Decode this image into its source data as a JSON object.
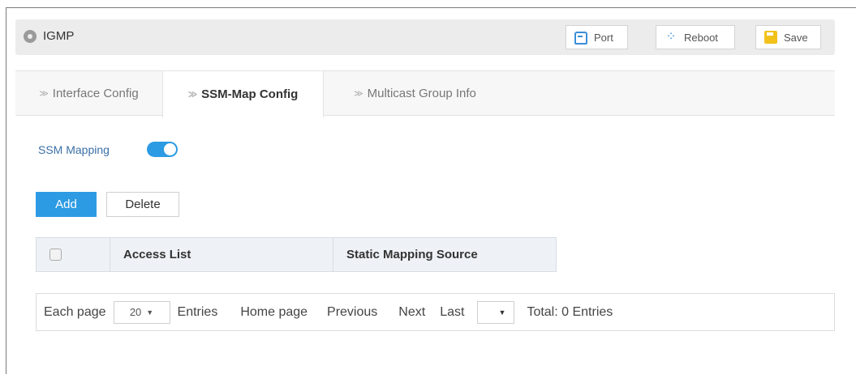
{
  "header": {
    "title": "IGMP",
    "buttons": {
      "port": "Port",
      "reboot": "Reboot",
      "save": "Save"
    }
  },
  "tabs": [
    {
      "label": "Interface Config",
      "active": false
    },
    {
      "label": "SSM-Map Config",
      "active": true
    },
    {
      "label": "Multicast Group Info",
      "active": false
    }
  ],
  "ssm": {
    "label": "SSM Mapping",
    "enabled": true
  },
  "actions": {
    "add": "Add",
    "delete": "Delete"
  },
  "table": {
    "columns": [
      "Access List",
      "Static Mapping Source"
    ],
    "rows": []
  },
  "pager": {
    "each_page": "Each page",
    "page_size": "20",
    "entries": "Entries",
    "home": "Home page",
    "previous": "Previous",
    "next": "Next",
    "last": "Last",
    "goto_value": "",
    "total": "Total: 0 Entries"
  },
  "colors": {
    "accent": "#2d9be3",
    "save_icon": "#f2c21b"
  }
}
